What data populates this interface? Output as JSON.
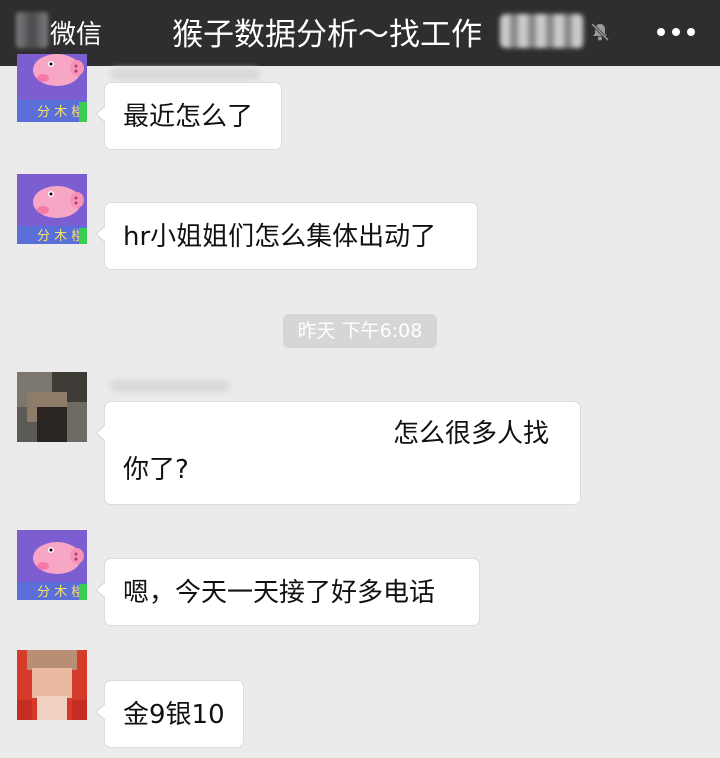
{
  "header": {
    "back_label": "微信",
    "title": "猴子数据分析～找工作"
  },
  "messages": [
    {
      "text": "最近怎么了"
    },
    {
      "text": "hr小姐姐们怎么集体出动了"
    },
    {
      "lines": [
        "怎么很多人找",
        "你了?"
      ]
    },
    {
      "text": "嗯，今天一天接了好多电话"
    },
    {
      "text": "金9银10"
    }
  ],
  "timestamp": "昨天 下午6:08",
  "colors": {
    "header_bg": "#2e2e30",
    "chat_bg": "#ebebeb",
    "bubble_bg": "#ffffff",
    "timestamp_bg": "#d6d6d6"
  },
  "icons": {
    "mute": "bell-muted-icon",
    "more": "more-dots-icon"
  }
}
